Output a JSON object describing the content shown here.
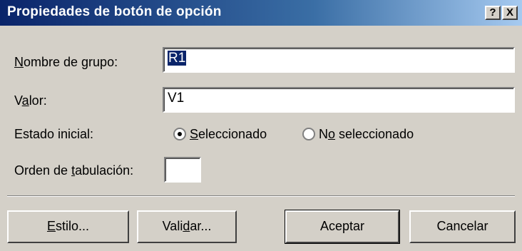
{
  "window": {
    "title": "Propiedades de botón de opción",
    "help_label": "?",
    "close_label": "X"
  },
  "form": {
    "group_name": {
      "label_accel": "N",
      "label_rest": "ombre de grupo:",
      "value": "R1"
    },
    "value_field": {
      "label_start": "V",
      "label_accel": "a",
      "label_rest": "lor:",
      "value": "V1"
    },
    "initial_state": {
      "label": "Estado inicial:",
      "selected": "Seleccionado",
      "options": [
        {
          "accel": "S",
          "rest": "eleccionado",
          "checked": true
        },
        {
          "start": "N",
          "accel": "o",
          "rest": " seleccionado",
          "checked": false
        }
      ]
    },
    "tab_order": {
      "label_start": "Orden de ",
      "label_accel": "t",
      "label_rest": "abulación:",
      "value": ""
    }
  },
  "buttons": {
    "style": {
      "accel": "E",
      "rest": "stilo..."
    },
    "validate": {
      "start": "Vali",
      "accel": "d",
      "rest": "ar..."
    },
    "accept": "Aceptar",
    "cancel": "Cancelar"
  }
}
